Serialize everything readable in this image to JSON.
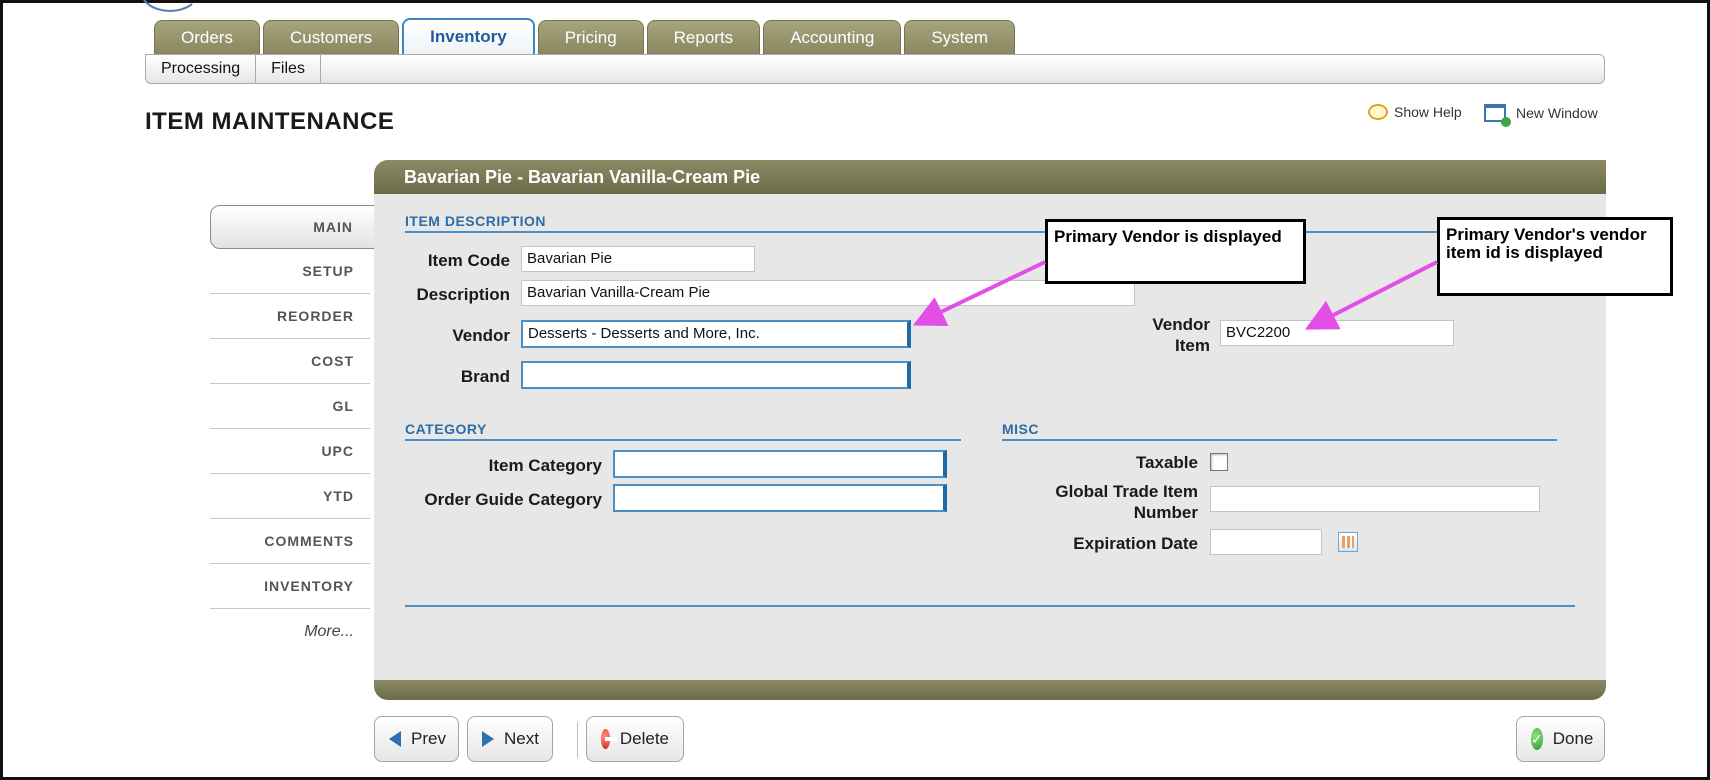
{
  "tabs": [
    {
      "label": "Orders",
      "active": false
    },
    {
      "label": "Customers",
      "active": false
    },
    {
      "label": "Inventory",
      "active": true
    },
    {
      "label": "Pricing",
      "active": false
    },
    {
      "label": "Reports",
      "active": false
    },
    {
      "label": "Accounting",
      "active": false
    },
    {
      "label": "System",
      "active": false
    }
  ],
  "subtabs": [
    "Processing",
    "Files"
  ],
  "page_title": "ITEM MAINTENANCE",
  "header_actions": {
    "show_help": "Show Help",
    "new_window": "New Window"
  },
  "leftnav": {
    "main": "MAIN",
    "items": [
      "SETUP",
      "REORDER",
      "COST",
      "GL",
      "UPC",
      "YTD",
      "COMMENTS",
      "INVENTORY"
    ],
    "more": "More..."
  },
  "panel_title": "Bavarian Pie - Bavarian Vanilla-Cream Pie",
  "item_description": {
    "heading": "ITEM DESCRIPTION",
    "item_code_label": "Item Code",
    "item_code_value": "Bavarian Pie",
    "description_label": "Description",
    "description_value": "Bavarian Vanilla-Cream Pie",
    "vendor_label": "Vendor",
    "vendor_value": "Desserts - Desserts and More, Inc.",
    "brand_label": "Brand",
    "brand_value": "",
    "vendor_item_label_1": "Vendor",
    "vendor_item_label_2": "Item",
    "vendor_item_value": "BVC2200"
  },
  "category": {
    "heading": "CATEGORY",
    "item_category_label": "Item Category",
    "item_category_value": "",
    "order_guide_label": "Order Guide Category",
    "order_guide_value": ""
  },
  "misc": {
    "heading": "MISC",
    "taxable_label": "Taxable",
    "taxable_checked": false,
    "gtin_label_1": "Global Trade Item",
    "gtin_label_2": "Number",
    "gtin_value": "",
    "expiration_label": "Expiration Date",
    "expiration_value": ""
  },
  "callouts": {
    "vendor": "Primary Vendor is displayed",
    "vendor_item_1": "Primary Vendor's vendor",
    "vendor_item_2": "item id is displayed",
    "arrow_color": "#e14fe6"
  },
  "buttons": {
    "prev": "Prev",
    "next": "Next",
    "delete": "Delete",
    "done": "Done"
  },
  "colors": {
    "tab_olive": "#8a8760",
    "accent_blue": "#2a6da8",
    "panel_bg": "#e7e7e7"
  }
}
